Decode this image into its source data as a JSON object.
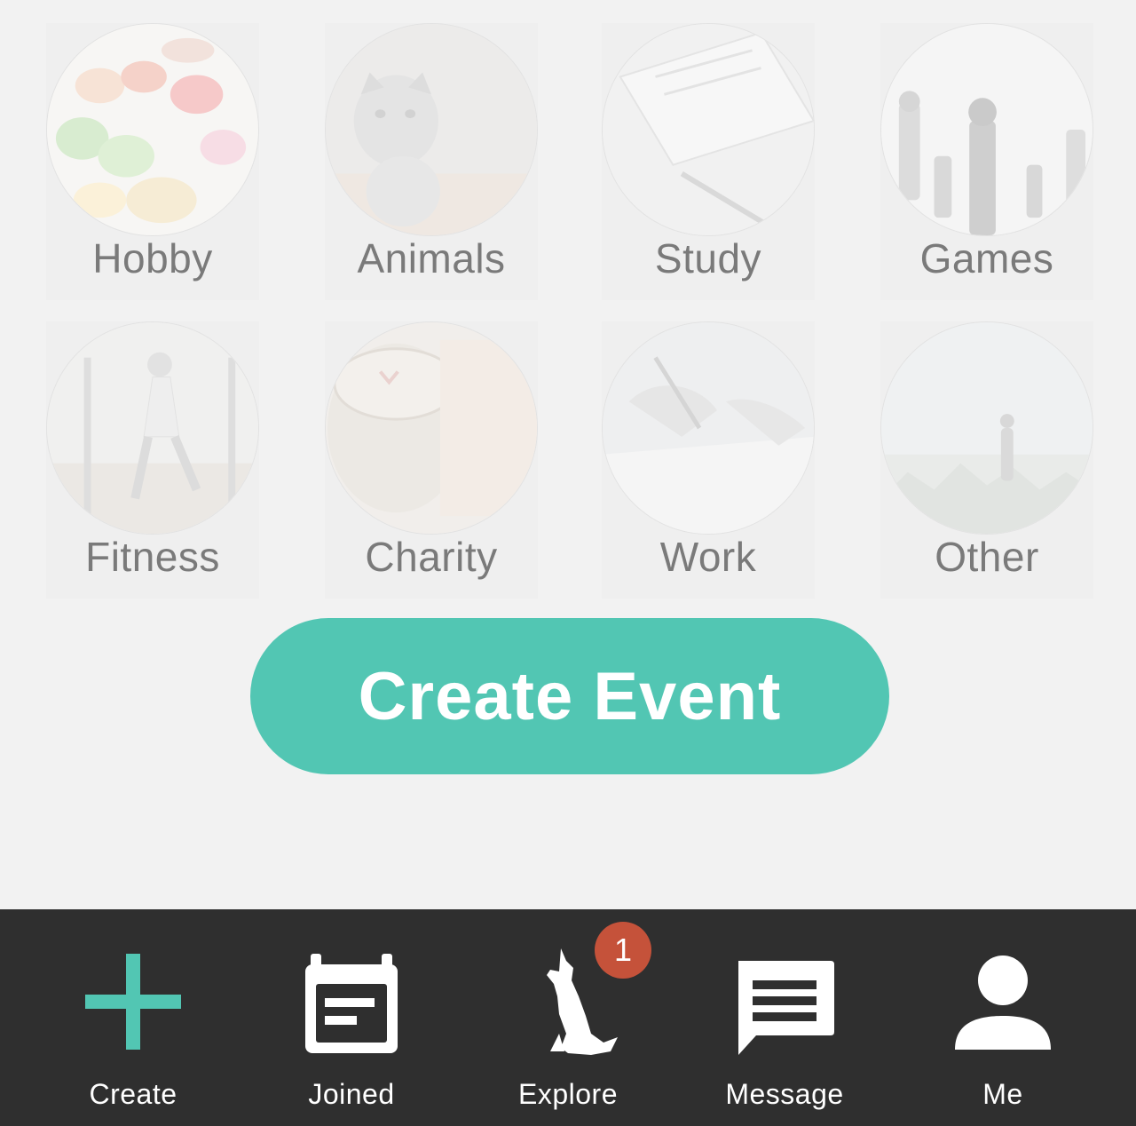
{
  "categories": [
    {
      "label": "Hobby",
      "icon": "paint-palette-image"
    },
    {
      "label": "Animals",
      "icon": "kitten-image"
    },
    {
      "label": "Study",
      "icon": "notebook-pen-image"
    },
    {
      "label": "Games",
      "icon": "chess-pieces-image"
    },
    {
      "label": "Fitness",
      "icon": "runner-image"
    },
    {
      "label": "Charity",
      "icon": "charity-jar-image"
    },
    {
      "label": "Work",
      "icon": "writing-hand-image"
    },
    {
      "label": "Other",
      "icon": "misty-landscape-image"
    }
  ],
  "actions": {
    "create_event_label": "Create Event",
    "accent_color": "#52c6b3"
  },
  "tabbar": {
    "background_color": "#2f2f2f",
    "tabs": [
      {
        "label": "Create",
        "icon": "plus-icon"
      },
      {
        "label": "Joined",
        "icon": "calendar-icon"
      },
      {
        "label": "Explore",
        "icon": "howling-wolf-icon"
      },
      {
        "label": "Message",
        "icon": "message-icon"
      },
      {
        "label": "Me",
        "icon": "person-icon"
      }
    ],
    "explore_badge": "1",
    "badge_color": "#c5523a"
  }
}
